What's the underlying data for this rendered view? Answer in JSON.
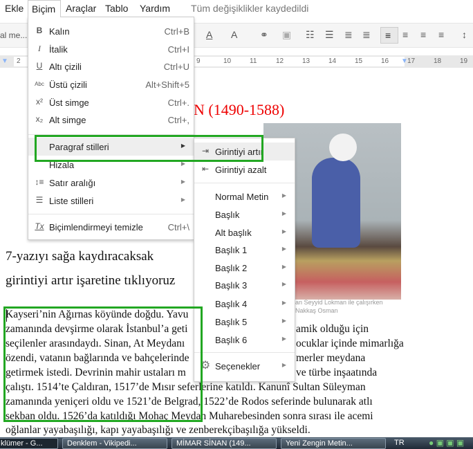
{
  "menubar": {
    "items": [
      "Ekle",
      "Biçim",
      "Araçlar",
      "Tablo",
      "Yardım"
    ],
    "status": "Tüm değişiklikler kaydedildi"
  },
  "toolbar": {
    "style_select": "al me...",
    "text_color": "A",
    "highlight": "A"
  },
  "ruler": [
    "2",
    "9",
    "10",
    "11",
    "12",
    "13",
    "14",
    "15",
    "16",
    "17",
    "18",
    "19"
  ],
  "format_menu": {
    "items": [
      {
        "icon": "bold-icon",
        "glyph": "B",
        "label": "Kalın",
        "shortcut": "Ctrl+B"
      },
      {
        "icon": "italic-icon",
        "glyph": "I",
        "label": "İtalik",
        "shortcut": "Ctrl+I"
      },
      {
        "icon": "underline-icon",
        "glyph": "U",
        "label": "Altı çizili",
        "shortcut": "Ctrl+U"
      },
      {
        "icon": "strikethrough-icon",
        "glyph": "Abc",
        "label": "Üstü çizili",
        "shortcut": "Alt+Shift+5"
      },
      {
        "icon": "superscript-icon",
        "glyph": "x²",
        "label": "Üst simge",
        "shortcut": "Ctrl+."
      },
      {
        "icon": "subscript-icon",
        "glyph": "x₂",
        "label": "Alt simge",
        "shortcut": "Ctrl+,"
      },
      {
        "label": "Paragraf stilleri"
      },
      {
        "label": "Hizala"
      },
      {
        "icon": "line-spacing-icon",
        "glyph": "↕≡",
        "label": "Satır aralığı"
      },
      {
        "icon": "list-icon",
        "glyph": "☰",
        "label": "Liste stilleri"
      },
      {
        "icon": "clear-formatting-icon",
        "glyph": "Tx",
        "label": "Biçimlendirmeyi temizle",
        "shortcut": "Ctrl+\\"
      }
    ]
  },
  "paragraph_submenu": {
    "indent_increase": "Girintiyi artır",
    "indent_decrease": "Girintiyi azalt",
    "styles": [
      "Normal Metin",
      "Başlık",
      "Alt başlık",
      "Başlık 1",
      "Başlık 2",
      "Başlık 3",
      "Başlık 4",
      "Başlık 5",
      "Başlık 6"
    ],
    "options": "Seçenekler"
  },
  "document": {
    "title": "N (1490-1588)",
    "instruction": [
      "7-yazıyı sağa kaydıracaksak",
      "girintiyi artır işaretine tıklıyoruz"
    ],
    "caption": [
      "an Seyyid Lokman ile çalışırken",
      "Nakkaş Osman"
    ],
    "lines": [
      {
        "left": "Kayseri’nin Ağırnas köyünde doğdu. Yavu",
        "right": ""
      },
      {
        "left": "zamanında devşirme olarak İstanbul’a geti",
        "right": "amik olduğu için"
      },
      {
        "left": "seçilenler arasındaydı. Sinan, At Meydanı",
        "right": "ocuklar içinde mimarlığa"
      },
      {
        "left": "özendi, vatanın bağlarında ve bahçelerinde",
        "right": "merler meydana"
      },
      {
        "left": "getirmek istedi. Devrinin mahir ustaları m",
        "right": "ve türbe inşaatında"
      },
      {
        "left": "çalıştı. 1514’te Çaldıran, 1517’de Mısır seferlerine katıldı. Kanunî Sultan Süleyman",
        "right": ""
      },
      {
        "left": "zamanında yeniçeri oldu ve 1521’de Belgrad, 1522’de Rodos seferinde bulunarak atlı",
        "right": ""
      },
      {
        "left": "sekban oldu. 1526’da katıldığı Mohaç Meydan Muharebesinden sonra sırası ile acemi",
        "right": ""
      },
      {
        "left": "oğlanlar yayabaşılığı, kapı yayabaşılığı ve zenberekçibaşılığa yükseldi.",
        "right": ""
      }
    ]
  },
  "taskbar": {
    "items": [
      "klümer - G...",
      "Denklem - Vikipedi...",
      "MİMAR SİNAN (149...",
      "Yeni Zengin Metin..."
    ],
    "lang": "TR"
  },
  "colors": {
    "highlight_box": "#22a722",
    "title": "#ee0000"
  }
}
